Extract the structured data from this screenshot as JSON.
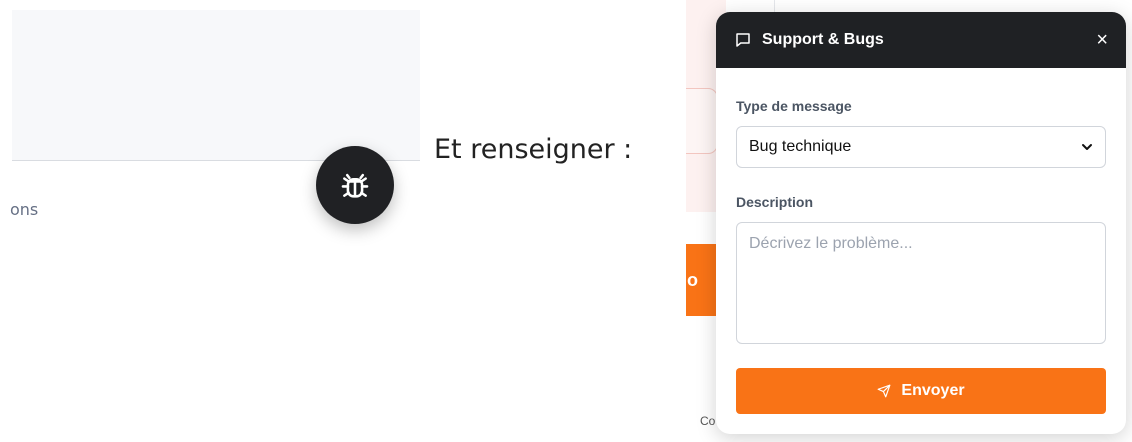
{
  "left_crop": {
    "partial_text": "ons"
  },
  "caption": "Et renseigner :",
  "background": {
    "orange_button_partial": "tio",
    "bottom_partial_text": "Co"
  },
  "panel": {
    "title": "Support & Bugs",
    "close_label": "×",
    "type_label": "Type de message",
    "type_value": "Bug technique",
    "description_label": "Description",
    "description_placeholder": "Décrivez le problème...",
    "submit_label": "Envoyer"
  },
  "colors": {
    "header_bg": "#1f2124",
    "accent": "#f97316",
    "fab_bg": "#202124"
  }
}
